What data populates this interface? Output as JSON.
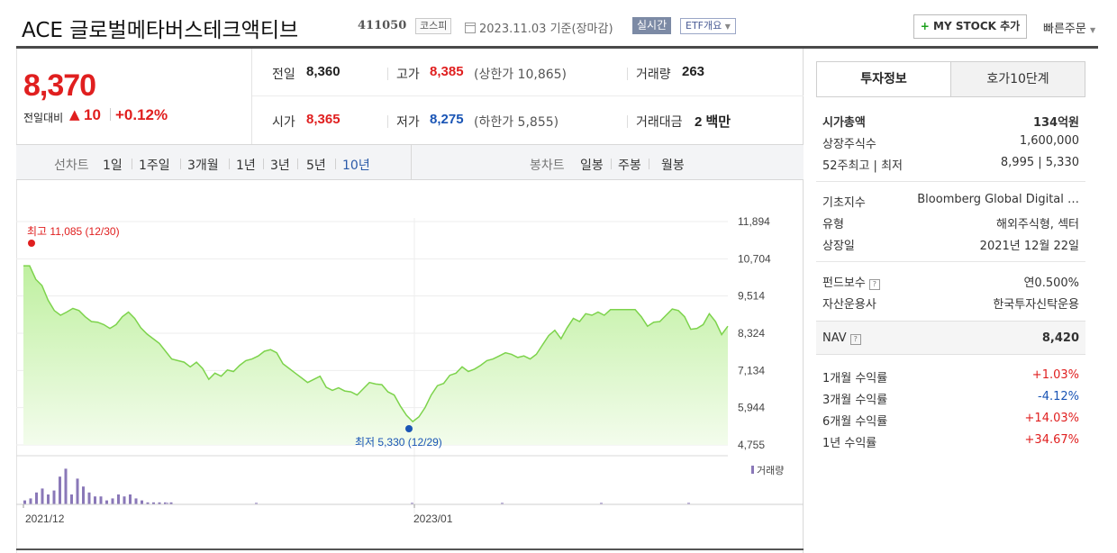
{
  "header": {
    "title": "ACE 글로벌메타버스테크액티브",
    "code": "411050",
    "market": "코스피",
    "date": "2023.11.03",
    "date_note": "기준(장마감)",
    "realtime": "실시간",
    "etf_overview": "ETF개요",
    "my_stock_button": "MY STOCK 추가",
    "my_stock_plus": "+",
    "quick_order": "빠른주문"
  },
  "price": {
    "current": "8,370",
    "change_label": "전일대비",
    "change_arrow": "▲",
    "change_value": "10",
    "change_pct": "+0.12%"
  },
  "stats": {
    "prev_label": "전일",
    "prev_value": "8,360",
    "high_label": "고가",
    "high_value": "8,385",
    "upper_limit": "(상한가 10,865)",
    "volume_label": "거래량",
    "volume_value": "263",
    "open_label": "시가",
    "open_value": "8,365",
    "low_label": "저가",
    "low_value": "8,275",
    "lower_limit": "(하한가 5,855)",
    "amount_label": "거래대금",
    "amount_value": "2 백만"
  },
  "periods": {
    "line_label": "선차트",
    "items": [
      "1일",
      "1주일",
      "3개월",
      "1년",
      "3년",
      "5년",
      "10년"
    ],
    "active": "10년",
    "candle_label": "봉차트",
    "candle_items": [
      "일봉",
      "주봉",
      "월봉"
    ]
  },
  "chart_data": {
    "type": "area",
    "x_labels": [
      "2021/12",
      "2023/01"
    ],
    "y_ticks": [
      "11,894",
      "10,704",
      "9,514",
      "8,324",
      "7,134",
      "5,944",
      "4,755"
    ],
    "ylim": [
      4755,
      11894
    ],
    "max_label": "최고 11,085 (12/30)",
    "min_label": "최저 5,330 (12/29)",
    "volume_legend": "거래량",
    "values": [
      10480,
      10480,
      10050,
      9850,
      9380,
      9050,
      8900,
      9000,
      9120,
      9050,
      8850,
      8700,
      8680,
      8600,
      8480,
      8600,
      8850,
      9000,
      8800,
      8500,
      8300,
      8150,
      8000,
      7750,
      7500,
      7450,
      7400,
      7250,
      7400,
      7200,
      6850,
      7050,
      6950,
      7150,
      7100,
      7300,
      7450,
      7500,
      7600,
      7750,
      7800,
      7700,
      7350,
      7200,
      7050,
      6900,
      6750,
      6850,
      6950,
      6600,
      6500,
      6580,
      6480,
      6450,
      6350,
      6550,
      6750,
      6700,
      6680,
      6450,
      6350,
      6000,
      5700,
      5500,
      5650,
      5950,
      6350,
      6650,
      6720,
      6980,
      7050,
      7250,
      7100,
      7180,
      7300,
      7450,
      7500,
      7600,
      7700,
      7650,
      7550,
      7600,
      7500,
      7650,
      7950,
      8250,
      8420,
      8150,
      8500,
      8800,
      8700,
      8950,
      8900,
      9000,
      8900,
      9080,
      9080,
      9080,
      9080,
      9080,
      8850,
      8550,
      8680,
      8700,
      8900,
      9100,
      9050,
      8850,
      8450,
      8480,
      8600,
      8950,
      8700,
      8280,
      8550
    ],
    "volume": [
      2,
      3,
      6,
      8,
      5,
      7,
      14,
      18,
      5,
      13,
      9,
      6,
      4,
      4,
      2,
      3,
      5,
      4,
      5,
      3,
      2,
      1,
      1,
      1,
      1,
      1,
      0,
      0,
      0,
      0
    ]
  },
  "panel": {
    "tabs": [
      "투자정보",
      "호가10단계"
    ],
    "market_cap_label": "시가총액",
    "market_cap_value": "134억원",
    "shares_label": "상장주식수",
    "shares_value": "1,600,000",
    "week52_label": "52주최고 | 최저",
    "week52_high": "8,995",
    "week52_low": "5,330",
    "index_label": "기초지수",
    "index_value": "Bloomberg Global Digital …",
    "type_label": "유형",
    "type_value": "해외주식형, 섹터",
    "listed_label": "상장일",
    "listed_value": "2021년 12월 22일",
    "fee_label": "펀드보수",
    "fee_value": "연0.500%",
    "manager_label": "자산운용사",
    "manager_value": "한국투자신탁운용",
    "nav_label": "NAV",
    "nav_value": "8,420",
    "returns": [
      {
        "label": "1개월 수익률",
        "value": "+1.03%",
        "sign": "pos"
      },
      {
        "label": "3개월 수익률",
        "value": "-4.12%",
        "sign": "neg"
      },
      {
        "label": "6개월 수익률",
        "value": "+14.03%",
        "sign": "pos"
      },
      {
        "label": "1년 수익률",
        "value": "+34.67%",
        "sign": "pos"
      }
    ]
  }
}
